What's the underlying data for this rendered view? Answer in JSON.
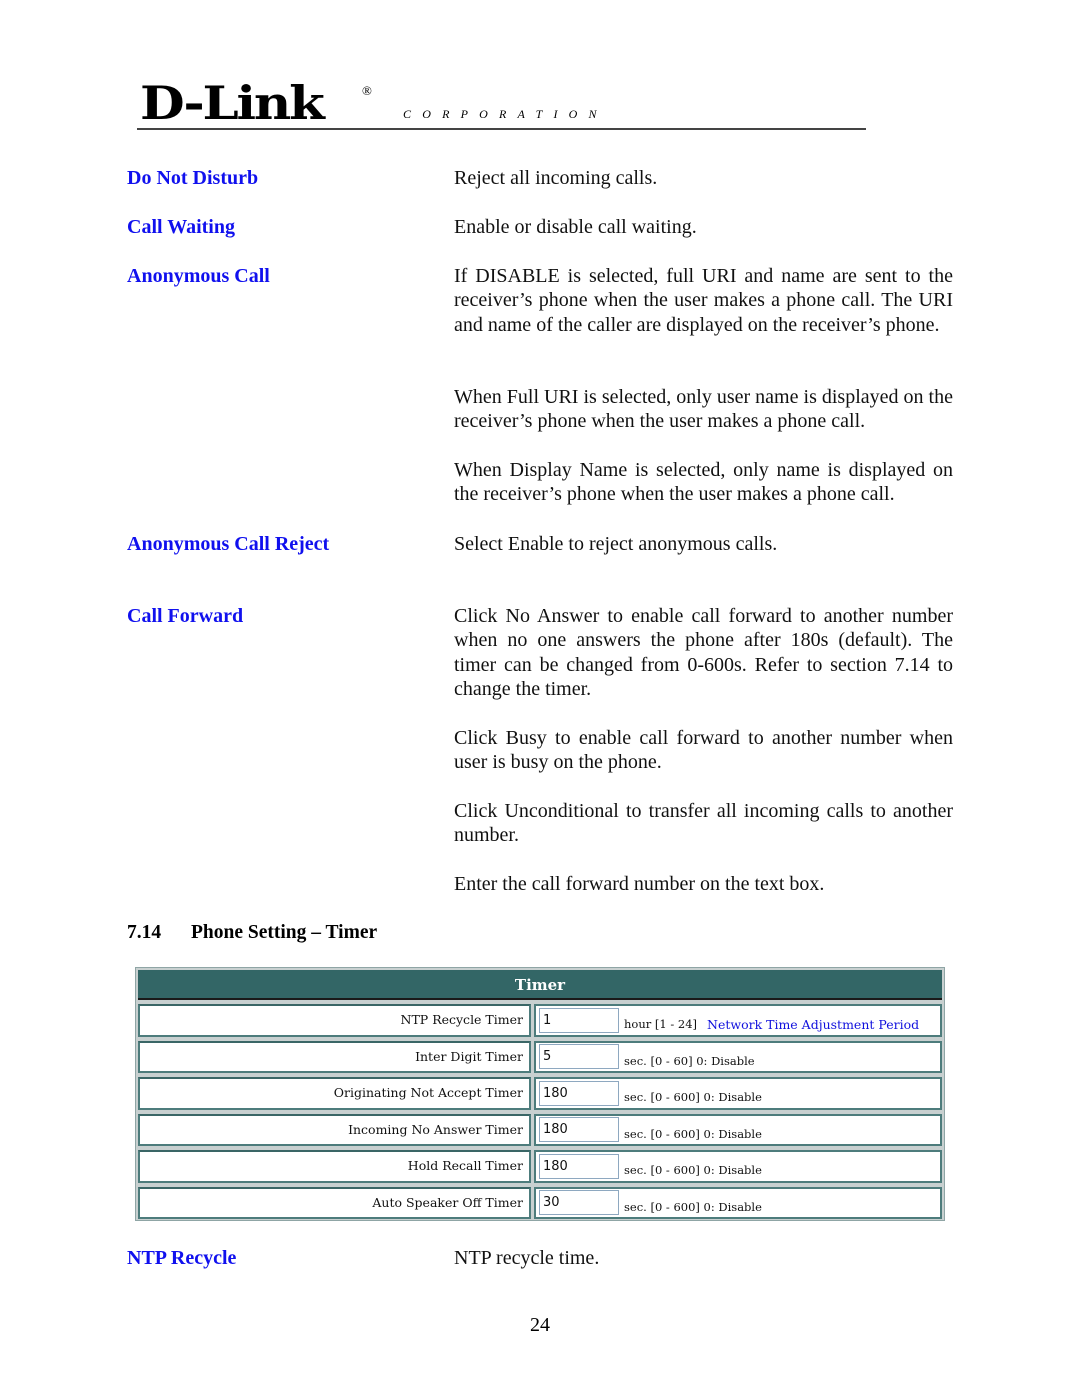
{
  "header": {
    "brand": "D-Link",
    "registered_mark": "®",
    "corporation": "CORPORATION"
  },
  "definitions": [
    {
      "term": "Do Not Disturb",
      "paragraphs": [
        "Reject all incoming calls."
      ]
    },
    {
      "term": "Call Waiting",
      "paragraphs": [
        "Enable or disable call waiting."
      ]
    },
    {
      "term": "Anonymous Call",
      "paragraphs": [
        "If DISABLE is selected, full URI and name are sent to the receiver’s phone when the user makes a phone call. The URI and name of the caller are displayed on the receiver’s phone.",
        "When Full URI is selected, only user name is displayed on the receiver’s phone when the user makes a phone call.",
        "When Display Name is selected, only name is displayed on the receiver’s phone when the user makes a phone call."
      ]
    },
    {
      "term": "Anonymous Call Reject",
      "paragraphs": [
        "Select Enable to reject anonymous calls."
      ]
    },
    {
      "term": "Call Forward",
      "paragraphs": [
        "Click No Answer to enable call forward to another number when no one answers the phone after 180s (default). The timer can be changed from 0-600s. Refer to section 7.14 to change the timer.",
        "Click Busy to enable call forward to another number when user is busy on the phone.",
        "Click Unconditional to transfer all incoming calls to another number.",
        "Enter the call forward number on the text box."
      ]
    }
  ],
  "section": {
    "number": "7.14",
    "title": "Phone Setting – Timer"
  },
  "timer_panel": {
    "title": "Timer",
    "rows": [
      {
        "label": "NTP Recycle Timer",
        "value": "1",
        "hint": "hour [1 - 24]",
        "note": "Network Time Adjustment Period"
      },
      {
        "label": "Inter Digit Timer",
        "value": "5",
        "hint": "sec. [0 - 60] 0: Disable"
      },
      {
        "label": "Originating Not Accept Timer",
        "value": "180",
        "hint": "sec. [0 - 600] 0: Disable"
      },
      {
        "label": "Incoming No Answer Timer",
        "value": "180",
        "hint": "sec. [0 - 600] 0: Disable"
      },
      {
        "label": "Hold Recall Timer",
        "value": "180",
        "hint": "sec. [0 - 600] 0: Disable"
      },
      {
        "label": "Auto Speaker Off Timer",
        "value": "30",
        "hint": "sec. [0 - 600] 0: Disable"
      }
    ]
  },
  "after_table": [
    {
      "term": "NTP Recycle",
      "paragraphs": [
        "NTP recycle time."
      ]
    }
  ],
  "footer": {
    "page_number": "24"
  },
  "colors": {
    "term_blue": "#1010ee",
    "panel_header": "#336666",
    "panel_border": "#4d7c7c"
  }
}
